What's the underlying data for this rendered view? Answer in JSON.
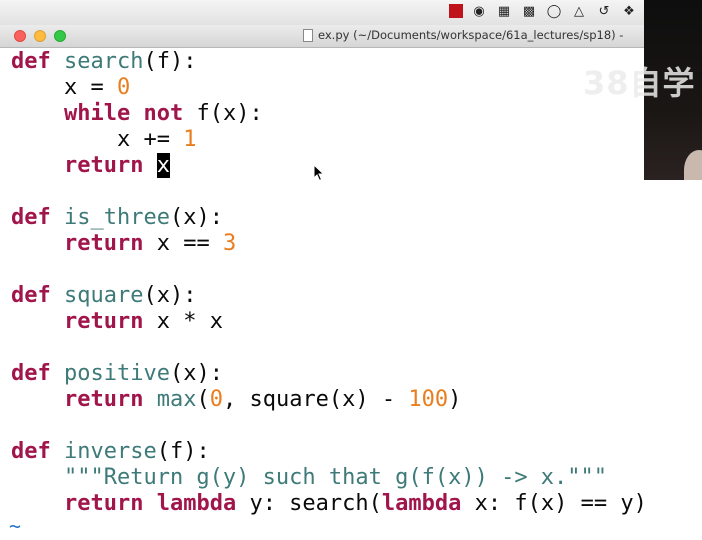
{
  "window": {
    "title": "ex.py (~/Documents/workspace/61a_lectures/sp18) - "
  },
  "menubar": {
    "icons": [
      "stop-record-icon",
      "eye-icon",
      "keyboard-icon",
      "display-icon",
      "paperclip-icon",
      "airplay-icon",
      "time-machine-icon",
      "bluetooth-icon"
    ]
  },
  "editor": {
    "lines": [
      {
        "parts": [
          {
            "t": "kw",
            "v": "def"
          },
          {
            "t": "txt",
            "v": " "
          },
          {
            "t": "fn",
            "v": "search"
          },
          {
            "t": "txt",
            "v": "(f):"
          }
        ]
      },
      {
        "parts": [
          {
            "t": "txt",
            "v": "    x = "
          },
          {
            "t": "num",
            "v": "0"
          }
        ]
      },
      {
        "parts": [
          {
            "t": "txt",
            "v": "    "
          },
          {
            "t": "kw",
            "v": "while"
          },
          {
            "t": "txt",
            "v": " "
          },
          {
            "t": "kw",
            "v": "not"
          },
          {
            "t": "txt",
            "v": " f(x):"
          }
        ]
      },
      {
        "parts": [
          {
            "t": "txt",
            "v": "        x += "
          },
          {
            "t": "num",
            "v": "1"
          }
        ]
      },
      {
        "parts": [
          {
            "t": "txt",
            "v": "    "
          },
          {
            "t": "kw",
            "v": "return"
          },
          {
            "t": "txt",
            "v": " "
          },
          {
            "t": "cursor",
            "v": "x"
          }
        ]
      },
      {
        "parts": []
      },
      {
        "parts": [
          {
            "t": "kw",
            "v": "def"
          },
          {
            "t": "txt",
            "v": " "
          },
          {
            "t": "fn",
            "v": "is_three"
          },
          {
            "t": "txt",
            "v": "(x):"
          }
        ]
      },
      {
        "parts": [
          {
            "t": "txt",
            "v": "    "
          },
          {
            "t": "kw",
            "v": "return"
          },
          {
            "t": "txt",
            "v": " x == "
          },
          {
            "t": "num",
            "v": "3"
          }
        ]
      },
      {
        "parts": []
      },
      {
        "parts": [
          {
            "t": "kw",
            "v": "def"
          },
          {
            "t": "txt",
            "v": " "
          },
          {
            "t": "fn",
            "v": "square"
          },
          {
            "t": "txt",
            "v": "(x):"
          }
        ]
      },
      {
        "parts": [
          {
            "t": "txt",
            "v": "    "
          },
          {
            "t": "kw",
            "v": "return"
          },
          {
            "t": "txt",
            "v": " x * x"
          }
        ]
      },
      {
        "parts": []
      },
      {
        "parts": [
          {
            "t": "kw",
            "v": "def"
          },
          {
            "t": "txt",
            "v": " "
          },
          {
            "t": "fn",
            "v": "positive"
          },
          {
            "t": "txt",
            "v": "(x):"
          }
        ]
      },
      {
        "parts": [
          {
            "t": "txt",
            "v": "    "
          },
          {
            "t": "kw",
            "v": "return"
          },
          {
            "t": "txt",
            "v": " "
          },
          {
            "t": "fn",
            "v": "max"
          },
          {
            "t": "txt",
            "v": "("
          },
          {
            "t": "num",
            "v": "0"
          },
          {
            "t": "txt",
            "v": ", square(x) - "
          },
          {
            "t": "num",
            "v": "100"
          },
          {
            "t": "txt",
            "v": ")"
          }
        ]
      },
      {
        "parts": []
      },
      {
        "parts": [
          {
            "t": "kw",
            "v": "def"
          },
          {
            "t": "txt",
            "v": " "
          },
          {
            "t": "fn",
            "v": "inverse"
          },
          {
            "t": "txt",
            "v": "(f):"
          }
        ]
      },
      {
        "parts": [
          {
            "t": "txt",
            "v": "    "
          },
          {
            "t": "str",
            "v": "\"\"\"Return g(y) such that g(f(x)) -> x.\"\"\""
          }
        ]
      },
      {
        "parts": [
          {
            "t": "txt",
            "v": "    "
          },
          {
            "t": "kw",
            "v": "return"
          },
          {
            "t": "txt",
            "v": " "
          },
          {
            "t": "kw",
            "v": "lambda"
          },
          {
            "t": "txt",
            "v": " y: search("
          },
          {
            "t": "kw",
            "v": "lambda"
          },
          {
            "t": "txt",
            "v": " x: f(x) == y)"
          }
        ]
      }
    ],
    "empty_line_marker": "~"
  },
  "watermark": "38自学"
}
